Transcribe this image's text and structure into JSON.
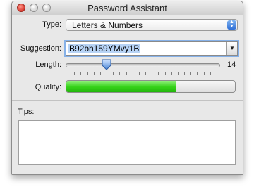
{
  "window": {
    "title": "Password Assistant"
  },
  "type": {
    "label": "Type:",
    "value": "Letters & Numbers"
  },
  "suggestion": {
    "label": "Suggestion:",
    "value": "B92bh159YMvy1B"
  },
  "length": {
    "label": "Length:",
    "value": "14",
    "min": 8,
    "max": 31,
    "tick_count": 24
  },
  "quality": {
    "label": "Quality:",
    "level": 0.65,
    "color": "#35d218"
  },
  "tips": {
    "label": "Tips:",
    "value": ""
  },
  "icons": {
    "window_close": "close-circle-icon",
    "window_minimize": "minimize-circle-icon",
    "window_zoom": "zoom-circle-icon",
    "popup_arrows": "up-down-arrows-icon",
    "combo_arrow": "chevron-down-icon"
  }
}
